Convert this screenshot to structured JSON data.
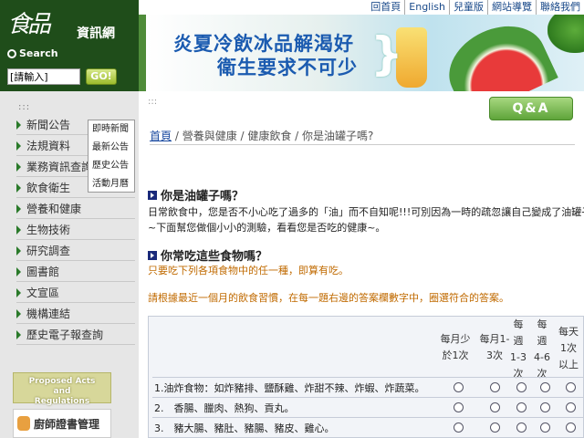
{
  "header": {
    "logo_glyphs": "食品",
    "site_name": "資訊網",
    "search_label": "Search",
    "search_value": "[請輸入]",
    "go_label": "GO!",
    "top_links": [
      "回首頁",
      "English",
      "兒童版",
      "網站導覽",
      "聯絡我們"
    ]
  },
  "banner": {
    "line1": "炎夏冷飲冰品解渴好",
    "line2": "衛生要求不可少",
    "brace": "}"
  },
  "sidebar": {
    "dots": ":::",
    "items": [
      {
        "label": "新聞公告"
      },
      {
        "label": "法規資料"
      },
      {
        "label": "業務資訊查詢"
      },
      {
        "label": "飲食衛生"
      },
      {
        "label": "營養和健康"
      },
      {
        "label": "生物技術"
      },
      {
        "label": "研究調查"
      },
      {
        "label": "圖書館"
      },
      {
        "label": "文宣區"
      },
      {
        "label": "機構連結"
      },
      {
        "label": "歷史電子報查詢"
      }
    ],
    "popup": [
      "即時新聞",
      "最新公告",
      "歷史公告",
      "活動月曆"
    ],
    "badge_acts": [
      "Proposed Acts",
      "and",
      "Regulations"
    ],
    "badge_chef": "廚師證書管理"
  },
  "main": {
    "dots": ":::",
    "qa_label": "Q&A",
    "breadcrumb": {
      "home": "首頁",
      "rest": " / 營養與健康 / 健康飲食 / 你是油罐子嗎?"
    },
    "section1_title": "你是油罐子嗎？",
    "intro1": "日常飲食中，您是否不小心吃了過多的「油」而不自知呢!!!可別因為一時的疏忽讓自己變成了油罐子喔",
    "intro2": "~下面幫您做個小小的測驗，看看您是否吃的健康~。",
    "section2_title": "你常吃這些食物嗎？",
    "section2_sub": "只要吃下列各項食物中的任一種，即算有吃。",
    "instruction": "請根據最近一個月的飲食習慣，在每一題右邊的答案欄數字中，圈選符合的答案。",
    "table": {
      "columns": [
        "每月少於1次",
        "每月1-3次",
        "每週1-3次",
        "每週4-6次",
        "每天1次以上"
      ],
      "rows": [
        "1.油炸食物：如炸豬排、鹽酥雞、炸甜不辣、炸蝦、炸蔬菜。",
        "2.　香腸、臘肉、熱狗、貢丸。",
        "3.　豬大腸、豬肚、豬腸、豬皮、雞心。"
      ]
    }
  }
}
